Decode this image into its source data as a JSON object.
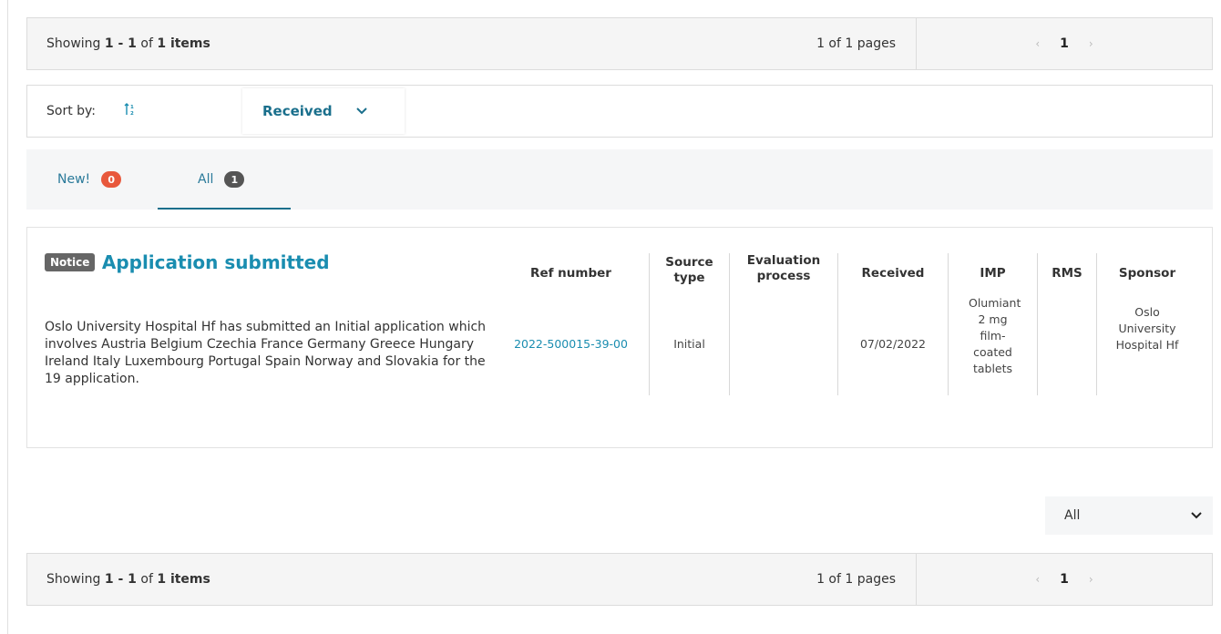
{
  "pager": {
    "showing_prefix": "Showing ",
    "range": "1 - 1",
    "of": " of ",
    "total": "1 items",
    "pages": "1 of 1 pages",
    "prev": "‹",
    "current_page": "1",
    "next": "›"
  },
  "sort": {
    "label": "Sort by:",
    "icon": "sort-ascending-icon",
    "selected": "Received",
    "chevron": "chevron-down-icon"
  },
  "tabs": [
    {
      "label": "New!",
      "count": "0"
    },
    {
      "label": "All",
      "count": "1"
    }
  ],
  "notice": {
    "badge": "Notice",
    "title": "Application submitted",
    "description": "Oslo University Hospital Hf has submitted an Initial application which involves Austria Belgium Czechia France Germany Greece Hungary Ireland Italy Luxembourg Portugal Spain Norway and Slovakia for the 19 application.",
    "columns": {
      "ref_number": {
        "header": "Ref number",
        "value": "2022-500015-39-00"
      },
      "source_type": {
        "header": "Source type",
        "value": "Initial"
      },
      "evaluation_process": {
        "header": "Evaluation process",
        "value": ""
      },
      "received": {
        "header": "Received",
        "value": "07/02/2022"
      },
      "imp": {
        "header": "IMP",
        "value": "Olumiant 2 mg film-coated tablets"
      },
      "rms": {
        "header": "RMS",
        "value": ""
      },
      "sponsor": {
        "header": "Sponsor",
        "value": "Oslo University Hospital Hf"
      }
    }
  },
  "filter": {
    "selected": "All"
  },
  "colors": {
    "accent": "#1a8db0",
    "badge_new": "#e8583c",
    "badge_all": "#555555",
    "notice_badge": "#666666"
  }
}
